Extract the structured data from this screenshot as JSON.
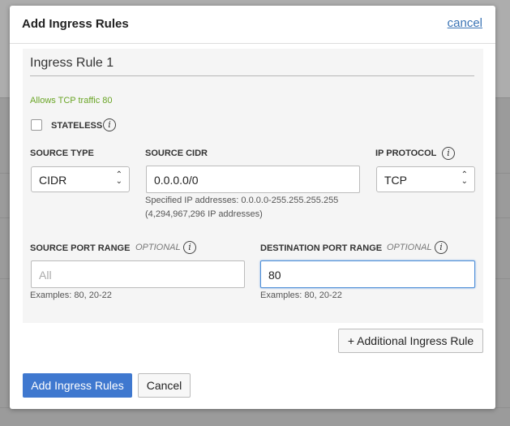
{
  "modal": {
    "title": "Add Ingress Rules",
    "cancel_link": "cancel"
  },
  "rule": {
    "title": "Ingress Rule 1",
    "summary": "Allows TCP traffic 80",
    "stateless_label": "STATELESS",
    "stateless_checked": false,
    "source_type": {
      "label": "SOURCE TYPE",
      "value": "CIDR"
    },
    "source_cidr": {
      "label": "SOURCE CIDR",
      "value": "0.0.0.0/0",
      "help_line1": "Specified IP addresses: 0.0.0.0-255.255.255.255",
      "help_line2": "(4,294,967,296 IP addresses)"
    },
    "ip_protocol": {
      "label": "IP PROTOCOL",
      "value": "TCP"
    },
    "source_port_range": {
      "label": "SOURCE PORT RANGE",
      "optional": "OPTIONAL",
      "placeholder": "All",
      "value": "",
      "help": "Examples: 80, 20-22"
    },
    "destination_port_range": {
      "label": "DESTINATION PORT RANGE",
      "optional": "OPTIONAL",
      "value": "80",
      "help": "Examples: 80, 20-22"
    }
  },
  "buttons": {
    "additional_rule": "+ Additional Ingress Rule",
    "submit": "Add Ingress Rules",
    "cancel": "Cancel"
  },
  "icons": {
    "info": "info-icon",
    "select_chevron": "chevron-up-down-icon"
  },
  "colors": {
    "accent": "#3f78cf",
    "summary_green": "#6aa526",
    "link": "#3b74b5"
  }
}
